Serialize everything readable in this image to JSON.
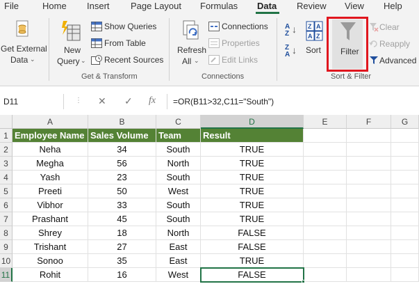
{
  "tabs": [
    "File",
    "Home",
    "Insert",
    "Page Layout",
    "Formulas",
    "Data",
    "Review",
    "View",
    "Help"
  ],
  "active_tab": "Data",
  "ribbon": {
    "get_external_data": {
      "line1": "Get External",
      "line2": "Data",
      "chevron": "⌄"
    },
    "new_query": {
      "line1": "New",
      "line2": "Query",
      "chevron": "⌄"
    },
    "show_queries": "Show Queries",
    "from_table": "From Table",
    "recent_sources": "Recent Sources",
    "group_get_transform": "Get & Transform",
    "refresh_all": {
      "line1": "Refresh",
      "line2": "All",
      "chevron": "⌄"
    },
    "connections": "Connections",
    "properties": "Properties",
    "edit_links": "Edit Links",
    "group_connections": "Connections",
    "sort": "Sort",
    "filter": "Filter",
    "clear": "Clear",
    "reapply": "Reapply",
    "advanced": "Advanced",
    "group_sort_filter": "Sort & Filter",
    "sort_az": {
      "top": "A",
      "bottom": "Z"
    },
    "sort_za": {
      "top": "Z",
      "bottom": "A"
    },
    "accent_color": "#217346",
    "highlight_color": "#e0161e"
  },
  "formula_bar": {
    "name_box": "D11",
    "cancel": "✕",
    "enter": "✓",
    "fx": "fx",
    "formula": "=OR(B11>32,C11=\"South\")"
  },
  "sheet": {
    "columns": [
      "A",
      "B",
      "C",
      "D",
      "E",
      "F",
      "G"
    ],
    "selected_column": "D",
    "rows": [
      "1",
      "2",
      "3",
      "4",
      "5",
      "6",
      "7",
      "8",
      "9",
      "10",
      "11"
    ],
    "selected_row": "11",
    "headers": [
      "Employee Name",
      "Sales Volume",
      "Team",
      "Result"
    ],
    "data": [
      [
        "Neha",
        "34",
        "South",
        "TRUE"
      ],
      [
        "Megha",
        "56",
        "North",
        "TRUE"
      ],
      [
        "Yash",
        "23",
        "South",
        "TRUE"
      ],
      [
        "Preeti",
        "50",
        "West",
        "TRUE"
      ],
      [
        "Vibhor",
        "33",
        "South",
        "TRUE"
      ],
      [
        "Prashant",
        "45",
        "South",
        "TRUE"
      ],
      [
        "Shrey",
        "18",
        "North",
        "FALSE"
      ],
      [
        "Trishant",
        "27",
        "East",
        "FALSE"
      ],
      [
        "Sonoo",
        "35",
        "East",
        "TRUE"
      ],
      [
        "Rohit",
        "16",
        "West",
        "FALSE"
      ]
    ],
    "header_fill": "#548235"
  }
}
